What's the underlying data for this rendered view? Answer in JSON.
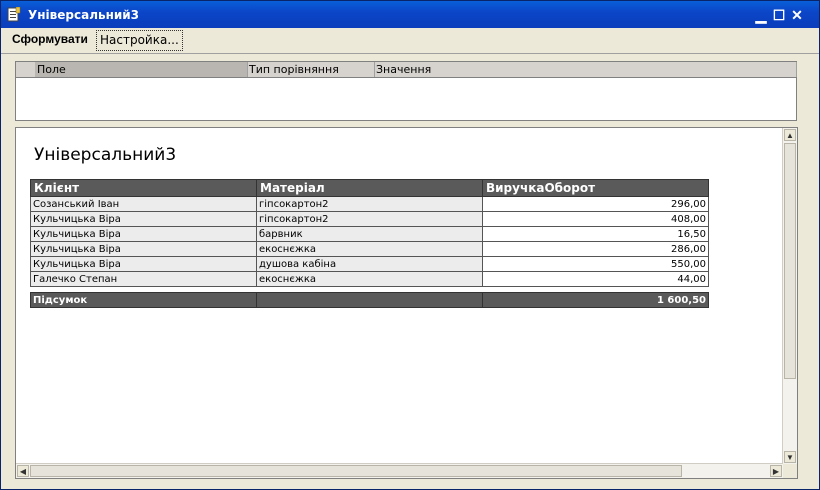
{
  "window": {
    "title": "Універсальний3",
    "minimize": "▁",
    "maximize": "☐",
    "close": "✕"
  },
  "toolbar": {
    "form_label": "Сформувати",
    "settings_label": "Настройка..."
  },
  "filter": {
    "columns": [
      "",
      "Поле",
      "Тип порівняння",
      "Значення"
    ]
  },
  "report": {
    "title": "Універсальний3",
    "headers": [
      "Клієнт",
      "Матеріал",
      "ВиручкаОборот"
    ],
    "rows": [
      {
        "client": "Созанський Іван",
        "material": "гіпсокартон2",
        "amount": "296,00"
      },
      {
        "client": "Кульчицька Віра",
        "material": "гіпсокартон2",
        "amount": "408,00"
      },
      {
        "client": "Кульчицька Віра",
        "material": "барвник",
        "amount": "16,50"
      },
      {
        "client": "Кульчицька Віра",
        "material": "екоснєжка",
        "amount": "286,00"
      },
      {
        "client": "Кульчицька Віра",
        "material": "душова кабіна",
        "amount": "550,00"
      },
      {
        "client": "Галечко Степан",
        "material": "екоснєжка",
        "amount": "44,00"
      }
    ],
    "total_label": "Підсумок",
    "total_value": "1 600,50"
  },
  "icons": {
    "app": "report-icon",
    "scroll_up": "▲",
    "scroll_down": "▼",
    "scroll_left": "◀",
    "scroll_right": "▶"
  },
  "colors": {
    "titlebar": "#0b46c8",
    "header_fill": "#5a5a5a",
    "cell_gray": "#ececec"
  }
}
